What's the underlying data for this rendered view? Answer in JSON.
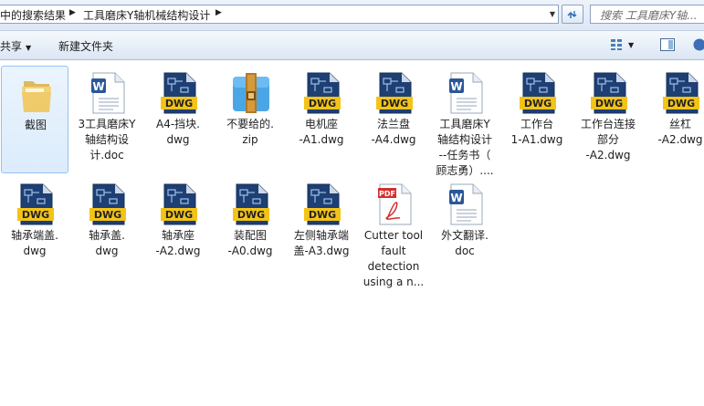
{
  "breadcrumb": {
    "parts": [
      "中的搜索结果",
      "工具磨床Y轴机械结构设计"
    ]
  },
  "search": {
    "placeholder": "搜索 工具磨床Y轴..."
  },
  "toolbar": {
    "share_label": "共享",
    "new_folder_label": "新建文件夹"
  },
  "colors": {
    "accent": "#3c78b5",
    "selection": "#dcecfc"
  },
  "files": [
    {
      "label": "截图",
      "icon": "folder-icon"
    },
    {
      "label": "3工具磨床Y\n轴结构设\n计.doc",
      "icon": "word-doc-icon"
    },
    {
      "label": "A4-挡块.\ndwg",
      "icon": "dwg-icon"
    },
    {
      "label": "不要给的.\nzip",
      "icon": "zip-icon"
    },
    {
      "label": "电机座\n-A1.dwg",
      "icon": "dwg-icon"
    },
    {
      "label": "法兰盘\n-A4.dwg",
      "icon": "dwg-icon"
    },
    {
      "label": "工具磨床Y\n轴结构设计\n--任务书（\n顾志勇）....",
      "icon": "word-doc-icon"
    },
    {
      "label": "工作台\n1-A1.dwg",
      "icon": "dwg-icon"
    },
    {
      "label": "工作台连接\n部分\n-A2.dwg",
      "icon": "dwg-icon"
    },
    {
      "label": "丝杠\n-A2.dwg",
      "icon": "dwg-icon"
    },
    {
      "label": "轴承端盖.\ndwg",
      "icon": "dwg-icon"
    },
    {
      "label": "轴承盖.\ndwg",
      "icon": "dwg-icon"
    },
    {
      "label": "轴承座\n-A2.dwg",
      "icon": "dwg-icon"
    },
    {
      "label": "装配图\n-A0.dwg",
      "icon": "dwg-icon"
    },
    {
      "label": "左侧轴承端\n盖-A3.dwg",
      "icon": "dwg-icon"
    },
    {
      "label": "Cutter tool\nfault\ndetection\nusing a n...",
      "icon": "pdf-icon"
    },
    {
      "label": "外文翻译.\ndoc",
      "icon": "word-doc-icon"
    }
  ],
  "icon_text": {
    "dwg": "DWG",
    "pdf": "PDF",
    "word": "W"
  }
}
